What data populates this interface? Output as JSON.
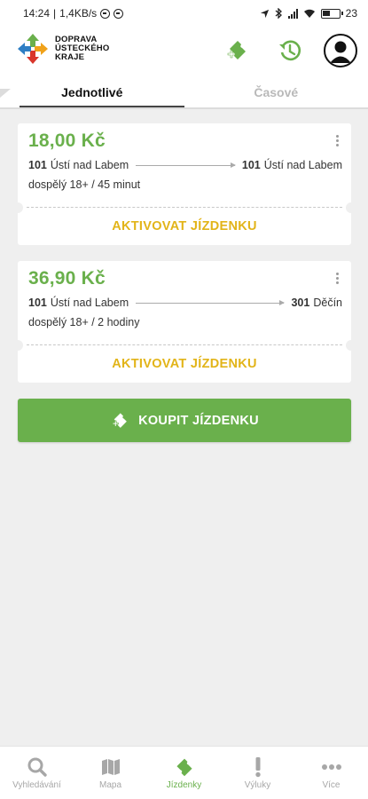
{
  "status_bar": {
    "time": "14:24",
    "network_speed": "1,4KB/s",
    "battery_percent": "23"
  },
  "header": {
    "logo_lines": [
      "DOPRAVA",
      "ÚSTECKÉHO",
      "KRAJE"
    ],
    "icons": [
      "buy-ticket-icon",
      "history-icon",
      "account-icon"
    ]
  },
  "tabs": [
    {
      "label": "Jednotlivé",
      "active": true
    },
    {
      "label": "Časové",
      "active": false
    }
  ],
  "tickets": [
    {
      "price": "18,00 Kč",
      "from_zone": "101",
      "from_name": "Ústí nad Labem",
      "to_zone": "101",
      "to_name": "Ústí nad Labem",
      "description": "dospělý 18+ / 45 minut",
      "action": "AKTIVOVAT JÍZDENKU"
    },
    {
      "price": "36,90 Kč",
      "from_zone": "101",
      "from_name": "Ústí nad Labem",
      "to_zone": "301",
      "to_name": "Děčín",
      "description": "dospělý 18+ / 2 hodiny",
      "action": "AKTIVOVAT JÍZDENKU"
    }
  ],
  "buy_button": {
    "label": "KOUPIT JÍZDENKU"
  },
  "bottom_nav": [
    {
      "label": "Vyhledávání",
      "icon": "search-icon",
      "active": false
    },
    {
      "label": "Mapa",
      "icon": "map-icon",
      "active": false
    },
    {
      "label": "Jízdenky",
      "icon": "ticket-icon",
      "active": true
    },
    {
      "label": "Výluky",
      "icon": "exclamation-icon",
      "active": false
    },
    {
      "label": "Více",
      "icon": "more-dots-icon",
      "active": false
    }
  ],
  "colors": {
    "brand_green": "#6ab04c",
    "action_yellow": "#e2b419",
    "inactive_gray": "#a7a7a7"
  }
}
